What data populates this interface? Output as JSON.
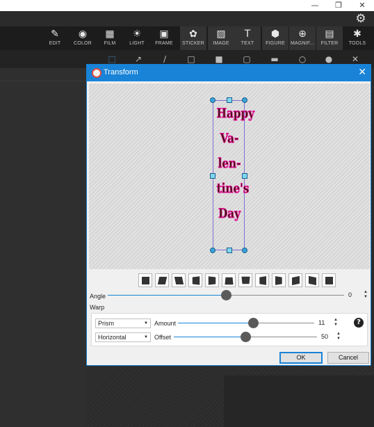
{
  "window": {
    "minimize_glyph": "—",
    "restore_glyph": "❐",
    "close_glyph": "✕"
  },
  "toolbar": {
    "tools": [
      {
        "label": "EDIT",
        "icon": "edit-icon",
        "glyph": "✎"
      },
      {
        "label": "COLOR",
        "icon": "color-icon",
        "glyph": "◉"
      },
      {
        "label": "FILM",
        "icon": "film-icon",
        "glyph": "▦"
      },
      {
        "label": "LIGHT",
        "icon": "light-icon",
        "glyph": "☀"
      },
      {
        "label": "FRAME",
        "icon": "frame-icon",
        "glyph": "▣"
      },
      {
        "label": "STICKER",
        "icon": "sticker-icon",
        "glyph": "✿"
      },
      {
        "label": "IMAGE",
        "icon": "image-icon",
        "glyph": "▨"
      },
      {
        "label": "TEXT",
        "icon": "text-icon",
        "glyph": "T"
      },
      {
        "label": "FIGURE",
        "icon": "figure-icon",
        "glyph": "⬢"
      },
      {
        "label": "MAGNIF...",
        "icon": "magnifier-icon",
        "glyph": "⊕"
      },
      {
        "label": "FILTER",
        "icon": "filter-icon",
        "glyph": "▤"
      },
      {
        "label": "TOOLS",
        "icon": "tools-icon",
        "glyph": "✱"
      }
    ],
    "settings_glyph": "⚙"
  },
  "dialog": {
    "title": "Transform",
    "close_glyph": "✕",
    "canvas_text": [
      "Happy",
      "Va-",
      "len-",
      "tine's",
      "Day"
    ],
    "shape_buttons": 12,
    "angle": {
      "label": "Angle",
      "value": "0",
      "fraction": 0.5
    },
    "warp": {
      "label": "Warp",
      "type": {
        "selected": "Prism"
      },
      "amount": {
        "label": "Amount",
        "value": "11",
        "fraction": 0.55
      },
      "direction": {
        "selected": "Horizontal"
      },
      "offset": {
        "label": "Offset",
        "value": "50",
        "fraction": 0.5
      }
    },
    "help_glyph": "?",
    "ok_label": "OK",
    "cancel_label": "Cancel"
  },
  "colors": {
    "accent": "#1883d7",
    "text_fill": "#3a1a0a",
    "text_outline": "#e8139a"
  }
}
